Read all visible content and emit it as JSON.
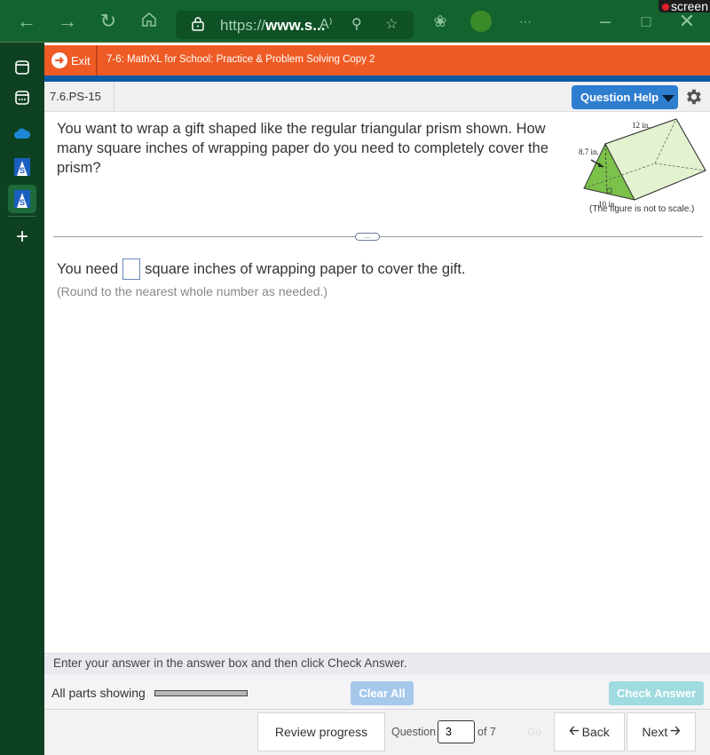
{
  "browser": {
    "url_prefix": "https://",
    "url_bold": "www.s...",
    "recording_label": "screen"
  },
  "course": {
    "exit_label": "Exit",
    "title": "7-6: MathXL for School: Practice & Problem Solving Copy 2"
  },
  "question": {
    "id": "7.6.PS-15",
    "help_label": "Question Help",
    "text": "You want to wrap a gift shaped like the regular triangular prism shown. How many square inches of wrapping paper do you need to completely cover the prism?",
    "figure": {
      "length_label": "12 in.",
      "height_label": "8.7 in.",
      "base_label": "10 in.",
      "note": "(The figure is not to scale.)"
    },
    "answer_prefix": "You need",
    "answer_suffix": "square inches of wrapping paper to cover the gift.",
    "answer_value": "",
    "hint": "(Round to the nearest whole number as needed.)"
  },
  "footer": {
    "instruction": "Enter your answer in the answer box and then click Check Answer.",
    "parts_label": "All parts showing",
    "clear_all_label": "Clear All",
    "check_answer_label": "Check Answer",
    "review_progress_label": "Review progress",
    "question_label": "Question",
    "question_number": "3",
    "question_total": "of 7",
    "go_label": "Go",
    "back_label": "Back",
    "next_label": "Next"
  }
}
